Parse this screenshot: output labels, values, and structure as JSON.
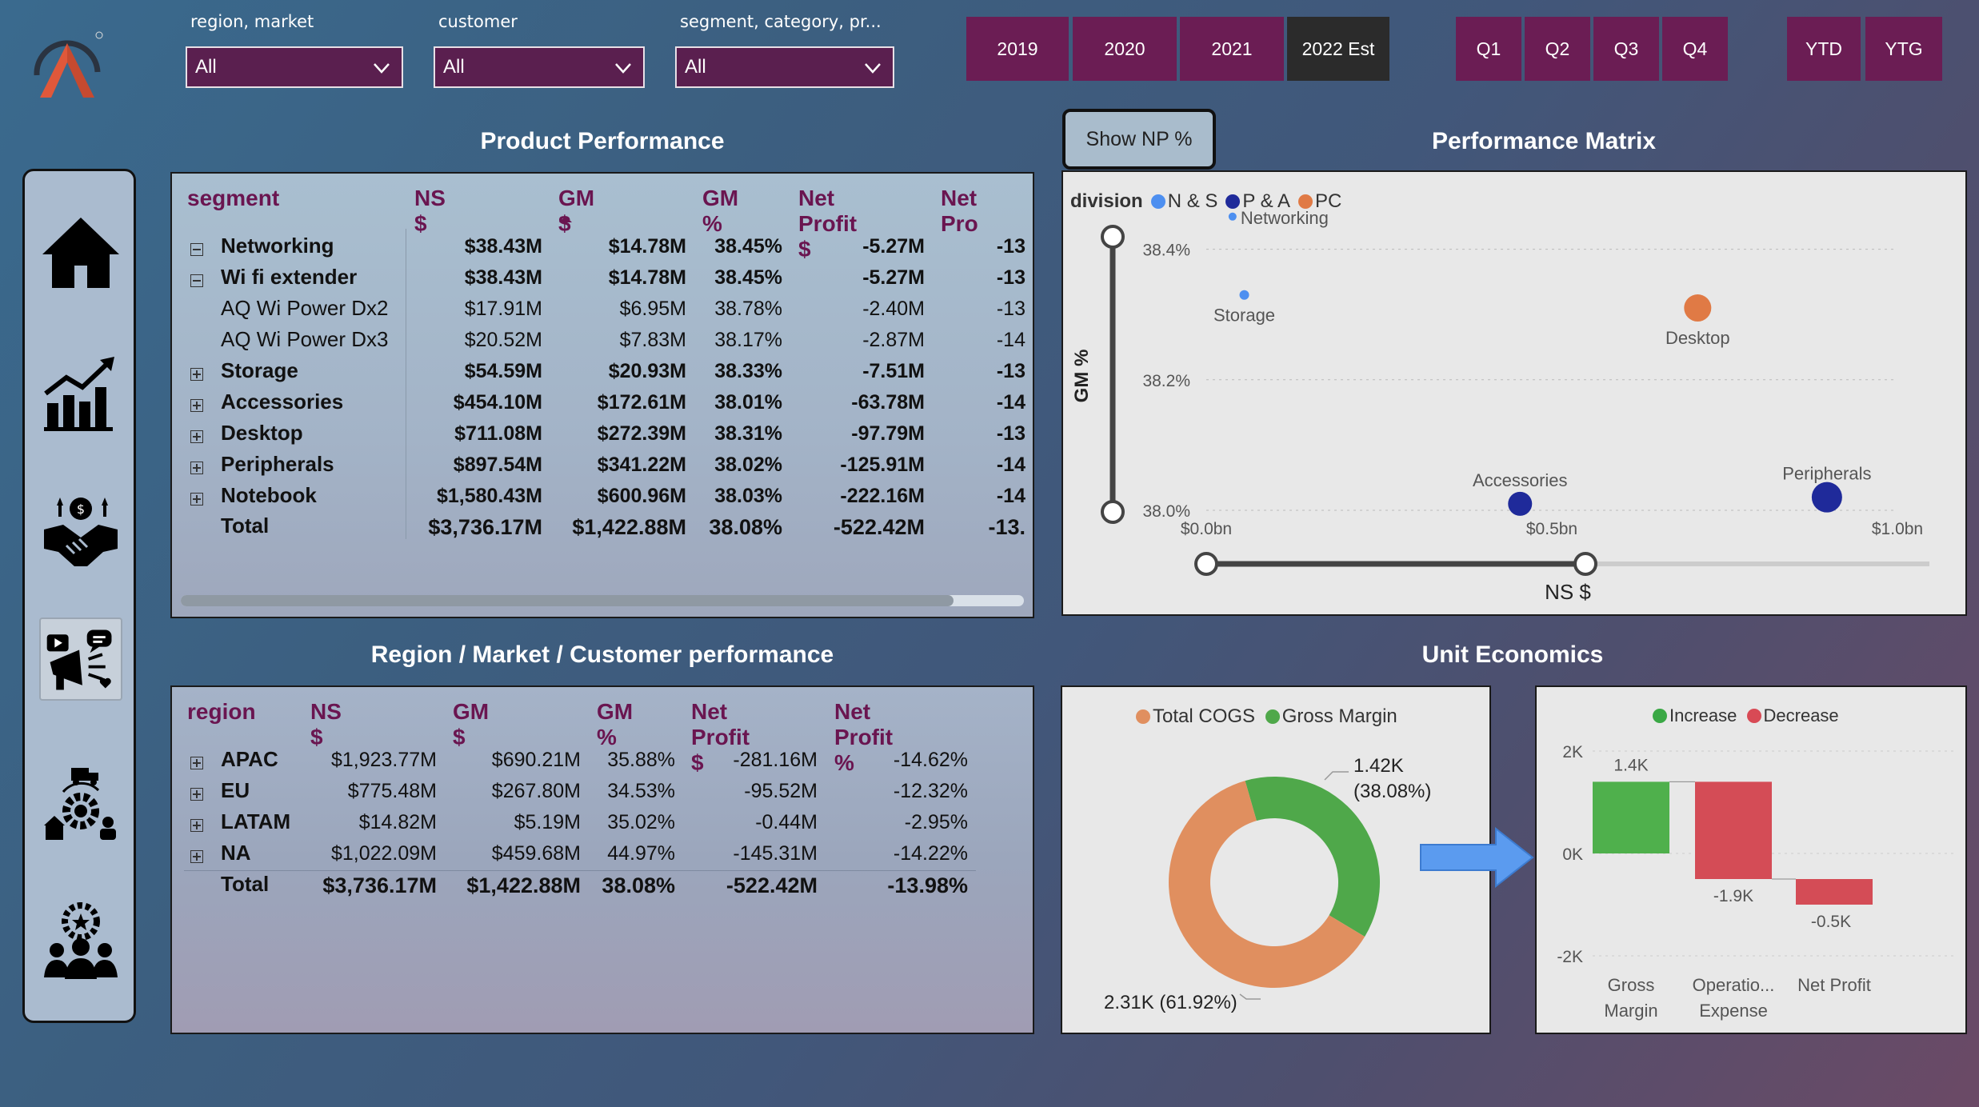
{
  "filters": [
    {
      "label": "region, market",
      "value": "All"
    },
    {
      "label": "customer",
      "value": "All"
    },
    {
      "label": "segment, category, pr...",
      "value": "All"
    }
  ],
  "years": [
    "2019",
    "2020",
    "2021",
    "2022 Est"
  ],
  "selected_year": "2022 Est",
  "quarters": [
    "Q1",
    "Q2",
    "Q3",
    "Q4"
  ],
  "periods": [
    "YTD",
    "YTG"
  ],
  "nav": [
    "home-icon",
    "growth-chart-icon",
    "deal-handshake-icon",
    "marketing-icon",
    "supply-chain-icon",
    "team-icon"
  ],
  "product": {
    "title": "Product Performance",
    "headers": [
      "segment",
      "NS $",
      "GM $",
      "GM %",
      "Net Profit $",
      "Net Pro"
    ],
    "rows": [
      {
        "label": "Networking",
        "exp": "minus",
        "bold": true,
        "ns": "$38.43M",
        "gm": "$14.78M",
        "gmp": "38.45%",
        "np": "-5.27M",
        "npp": "-13"
      },
      {
        "label": "Wi fi extender",
        "exp": "minus",
        "bold": true,
        "ns": "$38.43M",
        "gm": "$14.78M",
        "gmp": "38.45%",
        "np": "-5.27M",
        "npp": "-13"
      },
      {
        "label": "AQ Wi Power Dx2",
        "exp": "",
        "bold": false,
        "ns": "$17.91M",
        "gm": "$6.95M",
        "gmp": "38.78%",
        "np": "-2.40M",
        "npp": "-13"
      },
      {
        "label": "AQ Wi Power Dx3",
        "exp": "",
        "bold": false,
        "ns": "$20.52M",
        "gm": "$7.83M",
        "gmp": "38.17%",
        "np": "-2.87M",
        "npp": "-14"
      },
      {
        "label": "Storage",
        "exp": "plus",
        "bold": true,
        "ns": "$54.59M",
        "gm": "$20.93M",
        "gmp": "38.33%",
        "np": "-7.51M",
        "npp": "-13"
      },
      {
        "label": "Accessories",
        "exp": "plus",
        "bold": true,
        "ns": "$454.10M",
        "gm": "$172.61M",
        "gmp": "38.01%",
        "np": "-63.78M",
        "npp": "-14"
      },
      {
        "label": "Desktop",
        "exp": "plus",
        "bold": true,
        "ns": "$711.08M",
        "gm": "$272.39M",
        "gmp": "38.31%",
        "np": "-97.79M",
        "npp": "-13"
      },
      {
        "label": "Peripherals",
        "exp": "plus",
        "bold": true,
        "ns": "$897.54M",
        "gm": "$341.22M",
        "gmp": "38.02%",
        "np": "-125.91M",
        "npp": "-14"
      },
      {
        "label": "Notebook",
        "exp": "plus",
        "bold": true,
        "ns": "$1,580.43M",
        "gm": "$600.96M",
        "gmp": "38.03%",
        "np": "-222.16M",
        "npp": "-14"
      }
    ],
    "total": {
      "label": "Total",
      "ns": "$3,736.17M",
      "gm": "$1,422.88M",
      "gmp": "38.08%",
      "np": "-522.42M",
      "npp": "-13."
    }
  },
  "region": {
    "title": "Region / Market / Customer performance",
    "headers": [
      "region",
      "NS $",
      "GM $",
      "GM %",
      "Net Profit $",
      "Net Profit %"
    ],
    "rows": [
      {
        "label": "APAC",
        "ns": "$1,923.77M",
        "gm": "$690.21M",
        "gmp": "35.88%",
        "np": "-281.16M",
        "npp": "-14.62%"
      },
      {
        "label": "EU",
        "ns": "$775.48M",
        "gm": "$267.80M",
        "gmp": "34.53%",
        "np": "-95.52M",
        "npp": "-12.32%"
      },
      {
        "label": "LATAM",
        "ns": "$14.82M",
        "gm": "$5.19M",
        "gmp": "35.02%",
        "np": "-0.44M",
        "npp": "-2.95%"
      },
      {
        "label": "NA",
        "ns": "$1,022.09M",
        "gm": "$459.68M",
        "gmp": "44.97%",
        "np": "-145.31M",
        "npp": "-14.22%"
      }
    ],
    "total": {
      "label": "Total",
      "ns": "$3,736.17M",
      "gm": "$1,422.88M",
      "gmp": "38.08%",
      "np": "-522.42M",
      "npp": "-13.98%"
    }
  },
  "show_np_button": "Show NP %",
  "matrix": {
    "title": "Performance Matrix",
    "legend_title": "division",
    "legend": [
      {
        "name": "N & S",
        "color": "#4d8ff0"
      },
      {
        "name": "P & A",
        "color": "#1f2a9a"
      },
      {
        "name": "PC",
        "color": "#e07a45"
      }
    ],
    "yaxis": "GM %",
    "xaxis": "NS $",
    "yticks": [
      "38.4%",
      "38.2%",
      "38.0%"
    ],
    "xticks": [
      "$0.0bn",
      "$0.5bn",
      "$1.0bn"
    ]
  },
  "chart_data": [
    {
      "type": "scatter",
      "title": "Performance Matrix",
      "xlabel": "NS $",
      "ylabel": "GM %",
      "xlim": [
        0,
        1.0
      ],
      "ylim": [
        38.0,
        38.5
      ],
      "x_unit": "bn",
      "y_unit": "%",
      "points": [
        {
          "label": "Networking",
          "division": "N & S",
          "x": 0.038,
          "y": 38.45
        },
        {
          "label": "Storage",
          "division": "N & S",
          "x": 0.055,
          "y": 38.33
        },
        {
          "label": "Desktop",
          "division": "PC",
          "x": 0.711,
          "y": 38.31
        },
        {
          "label": "Accessories",
          "division": "P & A",
          "x": 0.454,
          "y": 38.01
        },
        {
          "label": "Peripherals",
          "division": "P & A",
          "x": 0.898,
          "y": 38.02
        }
      ]
    },
    {
      "type": "pie",
      "title": "Unit Economics",
      "legend": [
        "Total COGS",
        "Gross Margin"
      ],
      "slices": [
        {
          "name": "Total COGS",
          "value": 2.31,
          "label": "2.31K (61.92%)",
          "color": "#e08f5f"
        },
        {
          "name": "Gross Margin",
          "value": 1.42,
          "label": "1.42K (38.08%)",
          "color": "#4fa84a"
        }
      ]
    },
    {
      "type": "bar",
      "subtype": "waterfall",
      "legend": [
        "Increase",
        "Decrease"
      ],
      "categories": [
        "Gross Margin",
        "Operatio... Expense",
        "Net Profit"
      ],
      "values": [
        1.4,
        -1.9,
        -0.5
      ],
      "labels": [
        "1.4K",
        "-1.9K",
        "-0.5K"
      ],
      "yticks": [
        "2K",
        "0K",
        "-2K"
      ],
      "ylim": [
        -2,
        2
      ]
    }
  ],
  "unit_title": "Unit Economics",
  "pie_labels": {
    "gm": "1.42K",
    "gm_pct": "(38.08%)",
    "cogs": "2.31K (61.92%)"
  },
  "waterfall_labels": {
    "increase": "Increase",
    "decrease": "Decrease",
    "cat1a": "Gross",
    "cat1b": "Margin",
    "cat2a": "Operatio...",
    "cat2b": "Expense",
    "cat3": "Net Profit"
  }
}
